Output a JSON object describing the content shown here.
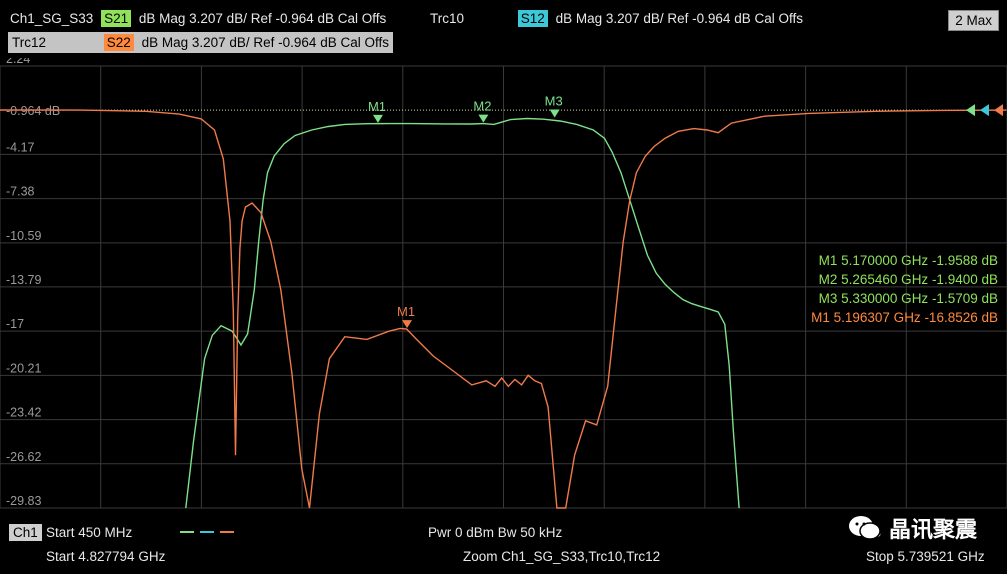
{
  "header": {
    "row1_left_name": "Ch1_SG_S33",
    "row1_left_param": "S21",
    "row1_left_info": "dB Mag  3.207 dB/ Ref -0.964 dB  Cal Offs",
    "row1_right_name": "Trc10",
    "row1_right_param": "S12",
    "row1_right_info": "dB Mag  3.207 dB/ Ref -0.964 dB  Cal Offs",
    "row2_name": "Trc12",
    "row2_param": "S22",
    "row2_info": "dB Mag  3.207 dB/ Ref -0.964 dB  Cal Offs",
    "max_button": "2 Max"
  },
  "colors": {
    "s21": "#8ee35a",
    "s12": "#3cc8d8",
    "s22": "#ff8a3d",
    "green_trace": "#7de18a",
    "orange_trace": "#f07a4a",
    "grid": "#3a3a3a",
    "ref": "#d7d7a0"
  },
  "ref_label": "-0.964 dB",
  "chart_data": {
    "type": "line",
    "x_unit": "GHz",
    "xlim": [
      4.827794,
      5.739521
    ],
    "ylim": [
      -29.83,
      2.24
    ],
    "y_ticks": [
      "2.24",
      "-0.964 dB",
      "-4.17",
      "-7.38",
      "-10.59",
      "-13.79",
      "-17",
      "-20.21",
      "-23.42",
      "-26.62",
      "-29.83"
    ],
    "y_tick_values": [
      2.24,
      -0.964,
      -4.17,
      -7.38,
      -10.59,
      -13.79,
      -17,
      -20.21,
      -23.42,
      -26.62,
      -29.83
    ],
    "series": [
      {
        "name": "S21",
        "color": "#7de18a",
        "x": [
          4.996,
          5.003,
          5.008,
          5.013,
          5.02,
          5.028,
          5.038,
          5.046,
          5.052,
          5.058,
          5.062,
          5.066,
          5.07,
          5.076,
          5.085,
          5.095,
          5.11,
          5.125,
          5.14,
          5.16,
          5.18,
          5.2,
          5.23,
          5.255,
          5.265,
          5.275,
          5.29,
          5.305,
          5.32,
          5.335,
          5.35,
          5.365,
          5.375,
          5.382,
          5.39,
          5.398,
          5.406,
          5.414,
          5.422,
          5.43,
          5.438,
          5.446,
          5.454,
          5.462,
          5.47,
          5.478,
          5.484,
          5.488,
          5.492,
          5.497
        ],
        "values": [
          -29.83,
          -25.0,
          -22.0,
          -19.0,
          -17.3,
          -16.6,
          -17.0,
          -18.0,
          -17.2,
          -14.0,
          -10.5,
          -7.5,
          -5.5,
          -4.3,
          -3.4,
          -2.8,
          -2.4,
          -2.15,
          -2.0,
          -1.95,
          -1.94,
          -1.94,
          -1.96,
          -1.97,
          -1.94,
          -2.0,
          -1.65,
          -1.57,
          -1.62,
          -1.75,
          -2.0,
          -2.4,
          -3.0,
          -4.0,
          -5.5,
          -7.5,
          -9.5,
          -11.5,
          -12.8,
          -13.6,
          -14.2,
          -14.7,
          -15.0,
          -15.2,
          -15.4,
          -15.6,
          -16.5,
          -19.5,
          -24.5,
          -29.83
        ]
      },
      {
        "name": "S22",
        "color": "#f07a4a",
        "x": [
          4.828,
          4.9,
          4.96,
          4.99,
          5.01,
          5.022,
          5.03,
          5.036,
          5.039,
          5.041,
          5.043,
          5.045,
          5.047,
          5.05,
          5.056,
          5.064,
          5.073,
          5.082,
          5.092,
          5.101,
          5.108,
          5.117,
          5.126,
          5.14,
          5.16,
          5.18,
          5.19,
          5.196,
          5.205,
          5.22,
          5.24,
          5.255,
          5.268,
          5.276,
          5.282,
          5.288,
          5.294,
          5.3,
          5.306,
          5.312,
          5.318,
          5.324,
          5.332,
          5.34,
          5.348,
          5.358,
          5.368,
          5.378,
          5.386,
          5.392,
          5.398,
          5.404,
          5.412,
          5.42,
          5.43,
          5.442,
          5.456,
          5.468,
          5.478,
          5.49,
          5.52,
          5.56,
          5.62,
          5.68,
          5.739
        ],
        "values": [
          -0.95,
          -0.96,
          -1.05,
          -1.25,
          -1.6,
          -2.4,
          -4.5,
          -9.0,
          -15.5,
          -26.0,
          -16.0,
          -11.0,
          -9.0,
          -8.0,
          -7.7,
          -8.4,
          -10.5,
          -14.0,
          -20.0,
          -27.0,
          -29.83,
          -23.0,
          -19.0,
          -17.4,
          -17.6,
          -17.0,
          -16.8,
          -16.85,
          -17.6,
          -18.8,
          -20.0,
          -20.9,
          -20.6,
          -21.0,
          -20.4,
          -21.0,
          -20.5,
          -20.9,
          -20.2,
          -20.6,
          -20.8,
          -22.5,
          -29.83,
          -29.83,
          -26.0,
          -23.5,
          -23.8,
          -21.0,
          -15.0,
          -10.5,
          -7.5,
          -5.5,
          -4.3,
          -3.6,
          -3.0,
          -2.5,
          -2.3,
          -2.4,
          -2.6,
          -1.9,
          -1.4,
          -1.2,
          -1.05,
          -0.98,
          -0.96
        ]
      }
    ],
    "markers": [
      {
        "label": "M1",
        "series": "S21",
        "x": 5.17,
        "y": -1.9588
      },
      {
        "label": "M2",
        "series": "S21",
        "x": 5.26546,
        "y": -1.94
      },
      {
        "label": "M3",
        "series": "S21",
        "x": 5.33,
        "y": -1.5709
      },
      {
        "label": "M1",
        "series": "S22",
        "x": 5.196307,
        "y": -16.8526
      }
    ]
  },
  "marker_table": [
    {
      "text": "M1  5.170000  GHz  -1.9588  dB",
      "color": "#8ee35a"
    },
    {
      "text": "M2  5.265460  GHz  -1.9400  dB",
      "color": "#8ee35a"
    },
    {
      "text": "M3  5.330000  GHz  -1.5709  dB",
      "color": "#8ee35a"
    },
    {
      "text": "M1  5.196307  GHz  -16.8526  dB",
      "color": "#ff8a3d"
    }
  ],
  "footer": {
    "channel": "Ch1",
    "start_span": "Start  450 MHz",
    "power": "Pwr  0 dBm  Bw  50 kHz",
    "start": "Start  4.827794  GHz",
    "zoom": "Zoom  Ch1_SG_S33,Trc10,Trc12",
    "stop": "Stop  5.739521  GHz",
    "stop_partial": "S",
    "watermark": "晶讯聚震"
  }
}
